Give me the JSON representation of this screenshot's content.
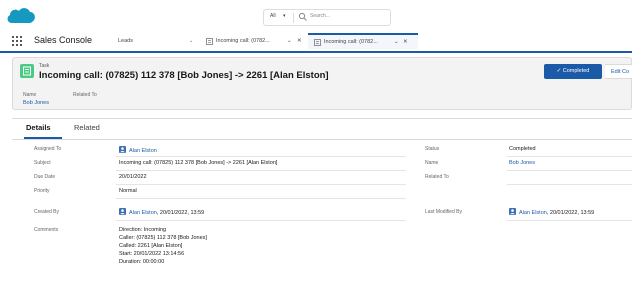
{
  "header": {
    "search_scope": "All",
    "search_placeholder": "Search..."
  },
  "nav": {
    "app_name": "Sales Console",
    "object_tab": "Leads",
    "tabs": [
      {
        "label": "Incoming call: (0782..."
      },
      {
        "label": "Incoming call: (0782..."
      }
    ]
  },
  "highlights": {
    "record_type": "Task",
    "title": "Incoming call: (07825) 112 378 [Bob Jones] -> 2261 [Alan Elston]",
    "completed_button": "Completed",
    "edit_button": "Edit Co",
    "name_label": "Name",
    "name_value": "Bob Jones",
    "related_label": "Related To"
  },
  "detail_tabs": [
    "Details",
    "Related"
  ],
  "fields": {
    "assigned_to_label": "Assigned To",
    "assigned_to_value": "Alan Elston",
    "status_label": "Status",
    "status_value": "Completed",
    "subject_label": "Subject",
    "subject_value": "Incoming call: (07825) 112 378 [Bob Jones] -> 2261 [Alan Elston]",
    "name_label": "Name",
    "name_value": "Bob Jones",
    "due_date_label": "Due Date",
    "due_date_value": "20/01/2022",
    "related_label": "Related To",
    "priority_label": "Priority",
    "priority_value": "Normal",
    "created_by_label": "Created By",
    "created_by_user": "Alan Elston",
    "created_by_date": ", 20/01/2022, 13:59",
    "modified_by_label": "Last Modified By",
    "modified_by_user": "Alan Elston",
    "modified_by_date": ", 20/01/2022, 13:59",
    "comments_label": "Comments",
    "comments_lines": [
      "Direction: Incoming",
      "Caller: (07825) 112 378 [Bob Jones]",
      "Called: 2261 [Alan Elston]",
      "Start: 20/01/2022 13:14:56",
      "Duration: 00:00:00"
    ]
  },
  "colors": {
    "brand_blue": "#1b5aa7",
    "task_green": "#4bca81",
    "salesforce_cloud": "#1798c1"
  }
}
